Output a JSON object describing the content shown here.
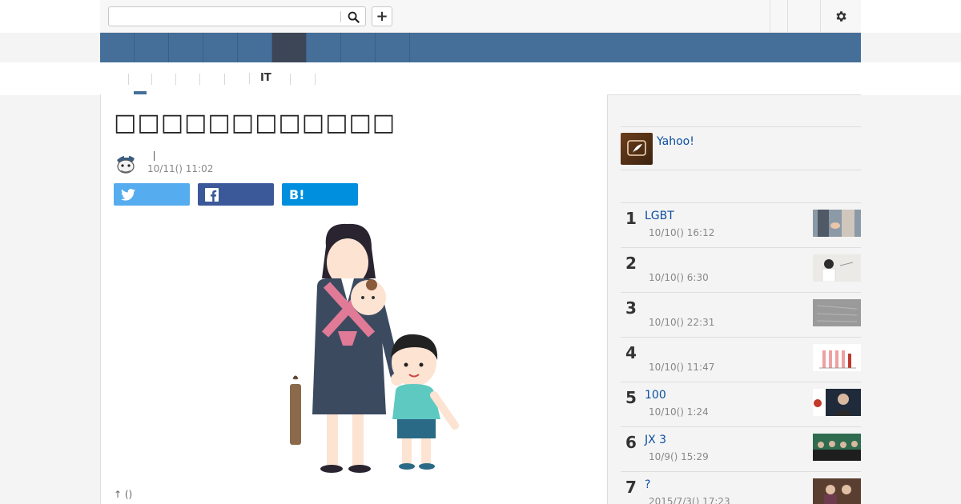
{
  "search": {
    "placeholder": "",
    "value": ""
  },
  "toolbar": {
    "plus_label": "+"
  },
  "bluenav": {
    "items": [
      "",
      "",
      "",
      "",
      "",
      "",
      "",
      "",
      ""
    ],
    "active_index": 5
  },
  "subnav": {
    "items": [
      "",
      "",
      "",
      "",
      "",
      "IT",
      ""
    ]
  },
  "article": {
    "title": "□□□□□□□□□□□□",
    "author_name": "",
    "date": "10/11() 11:02",
    "share": {
      "twitter": "",
      "facebook": "",
      "hatena": "B!"
    },
    "caption": "↑ ()"
  },
  "sidebar": {
    "promo_link": "Yahoo!",
    "ranking": [
      {
        "rank": "1",
        "title": "LGBT",
        "date": "10/10() 16:12"
      },
      {
        "rank": "2",
        "title": "",
        "date": "10/10() 6:30"
      },
      {
        "rank": "3",
        "title": "",
        "date": "10/10() 22:31"
      },
      {
        "rank": "4",
        "title": "",
        "date": "10/10() 11:47"
      },
      {
        "rank": "5",
        "title": "100",
        "date": "10/10() 1:24"
      },
      {
        "rank": "6",
        "title": "JX 3",
        "date": "10/9() 15:29"
      },
      {
        "rank": "7",
        "title": "?",
        "date": "2015/7/3() 17:23"
      }
    ]
  },
  "colors": {
    "nav_blue": "#456f99",
    "nav_active": "#3c4656",
    "link_blue": "#0b4fa0",
    "twitter": "#55acee",
    "facebook": "#3b5998",
    "hatena": "#008fde"
  },
  "icons": [
    "search-icon",
    "gear-icon",
    "twitter-icon",
    "facebook-icon",
    "quill-icon"
  ]
}
